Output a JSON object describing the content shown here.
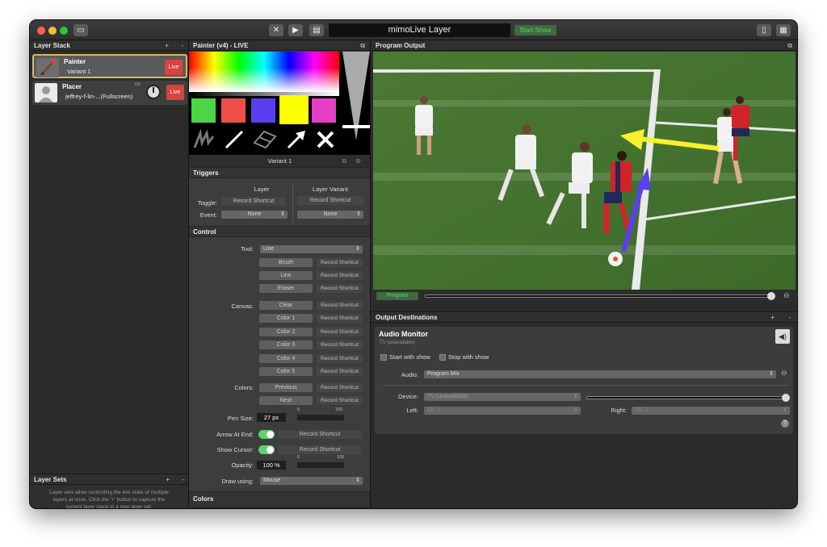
{
  "window": {
    "title": "mimoLive Layer",
    "start_show": "Start Show"
  },
  "colors": {
    "live": "#d9423e",
    "accent_green": "#5fd16f",
    "swatches": [
      "#4cd646",
      "#ef4f4a",
      "#5a3ff0",
      "#fcff00",
      "#e63ec4"
    ]
  },
  "layer_stack": {
    "header": "Layer Stack",
    "add": "+",
    "remove": "-",
    "items": [
      {
        "name": "Painter",
        "variant": "Variant 1",
        "live": "Live",
        "icon": "paintbrush-icon"
      },
      {
        "name": "Placer",
        "variant": "jeffrey-f-lin-...(Fullscreen)",
        "live": "Live",
        "icon": "person-silhouette-icon",
        "badge": "YP"
      }
    ]
  },
  "layer_sets": {
    "header": "Layer Sets",
    "add": "+",
    "remove": "-",
    "help": "Layer sets allow controlling the live state of multiple layers at once. Click the '+' button to capture the current layer stack in a new layer set."
  },
  "painter": {
    "header": "Painter (v4) - LIVE",
    "variant": "Variant 1",
    "triggers": {
      "title": "Triggers",
      "col_layer": "Layer",
      "col_variant": "Layer Variant",
      "toggle_label": "Toggle:",
      "event_label": "Event:",
      "record": "Record Shortcut",
      "none": "None"
    },
    "control": {
      "title": "Control",
      "tool_label": "Tool:",
      "tool_value": "Line",
      "tools": [
        "Brush",
        "Line",
        "Eraser"
      ],
      "canvas_label": "Canvas:",
      "canvas": [
        "Clear",
        "Color 1",
        "Color 2",
        "Color 3",
        "Color 4",
        "Color 5"
      ],
      "colors_label": "Colors:",
      "colors": [
        "Previous",
        "Next"
      ],
      "record": "Record Shortcut",
      "pen_size_label": "Pen Size:",
      "pen_size": "27 px",
      "pen_min": "0",
      "pen_max": "100",
      "arrow_label": "Arrow At End:",
      "cursor_label": "Show Cursor:",
      "opacity_label": "Opacity:",
      "opacity": "100 %",
      "opacity_min": "0",
      "opacity_max": "100",
      "draw_label": "Draw using:",
      "draw_value": "Mouse"
    },
    "colors_title": "Colors"
  },
  "program": {
    "header": "Program Output",
    "button": "Program"
  },
  "output": {
    "header": "Output Destinations",
    "add": "+",
    "remove": "-",
    "title": "Audio Monitor",
    "subtitle": "TV (unavailable)",
    "start_with_show": "Start with show",
    "stop_with_show": "Stop with show",
    "audio_label": "Audio:",
    "audio_value": "Program Mix",
    "device_label": "Device:",
    "device_value": "TV (unavailable)",
    "left_label": "Left:",
    "left_value": "Ch. 1",
    "right_label": "Right:",
    "right_value": "Ch. 2",
    "help": "?"
  }
}
